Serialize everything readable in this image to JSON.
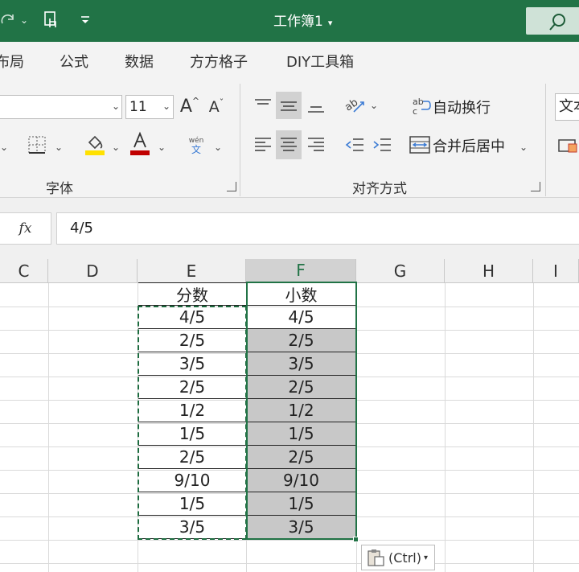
{
  "window": {
    "title": "工作簿1",
    "title_caret": "▾"
  },
  "titlebar_icons": [
    "redo-icon",
    "chevron-down-icon",
    "touch-mode-icon",
    "customize-qat-icon"
  ],
  "menu": {
    "tabs": [
      "布局",
      "公式",
      "数据",
      "方方格子",
      "DIY工具箱"
    ]
  },
  "ribbon": {
    "font": {
      "font_name": "",
      "font_size": "11",
      "grow_label": "A",
      "shrink_label": "A",
      "group_label": "字体",
      "font_color": "#c00000",
      "highlight_color": "#ffe100",
      "phonetic_top": "wén",
      "phonetic_bottom": "文"
    },
    "alignment": {
      "wrap_text_label": "自动换行",
      "merge_center_label": "合并后居中",
      "group_label": "对齐方式"
    },
    "number": {
      "format_value": "文本"
    }
  },
  "formula_bar": {
    "fx_label": "fx",
    "value": "4/5"
  },
  "columns": [
    "C",
    "D",
    "E",
    "F",
    "G",
    "H",
    "I"
  ],
  "sheet": {
    "header_e": "分数",
    "header_f": "小数",
    "fractions": [
      "4/5",
      "2/5",
      "3/5",
      "2/5",
      "1/2",
      "1/5",
      "2/5",
      "9/10",
      "1/5",
      "3/5"
    ],
    "decimals": [
      "4/5",
      "2/5",
      "3/5",
      "2/5",
      "1/2",
      "1/5",
      "2/5",
      "9/10",
      "1/5",
      "3/5"
    ]
  },
  "paste_options": {
    "label": "(Ctrl)",
    "arrow": "▾"
  },
  "colors": {
    "accent": "#217346",
    "selection_fill": "#c8c8c8"
  }
}
